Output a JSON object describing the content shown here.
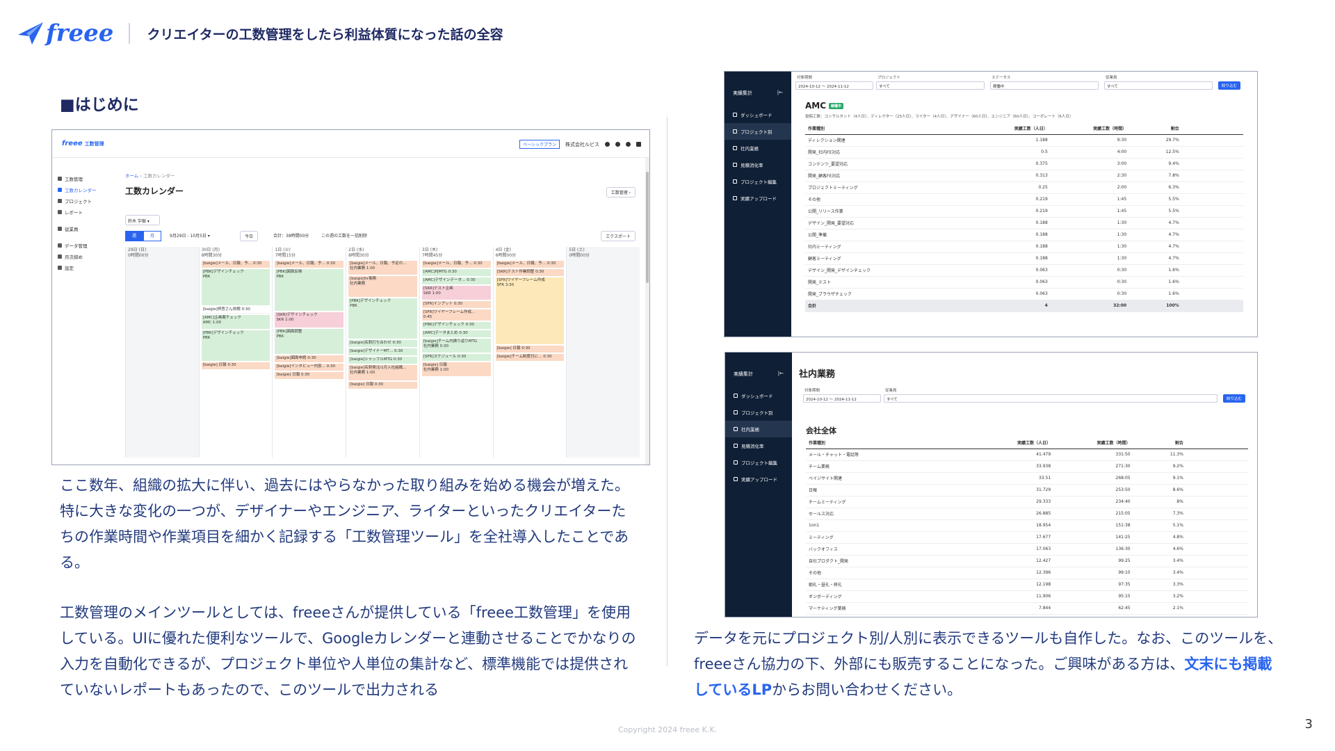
{
  "header": {
    "logo_text": "freee",
    "title": "クリエイターの工数管理をしたら利益体質になった話の全容"
  },
  "section_heading": "■はじめに",
  "paragraphs": {
    "p1": "ここ数年、組織の拡大に伴い、過去にはやらなかった取り組みを始める機会が増えた。特に大きな変化の一つが、デザイナーやエンジニア、ライターといったクリエイターたちの作業時間や作業項目を細かく記録する「工数管理ツール」を全社導入したことである。",
    "p2": "工数管理のメインツールとしては、freeeさんが提供している「freee工数管理」を使用している。UIに優れた便利なツールで、Googleカレンダーと連動させることでかなりの入力を自動化できるが、プロジェクト単位や人単位の集計など、標準機能では提供されていないレポートもあったので、このツールで出力される",
    "p3_pre": "データを元にプロジェクト別/人別に表示できるツールも自作した。なお、このツールを、freeeさん協力の下、外部にも販売することになった。ご興味がある方は、",
    "p3_link": "文末にも掲載しているLP",
    "p3_post": "からお問い合わせください。"
  },
  "footer": "Copyright 2024 freee K.K.",
  "page_number": "3",
  "calendar": {
    "logo": "freee",
    "app_name": "工数管理",
    "plan": "ベーシックプラン",
    "company": "株式会社ルビス",
    "sidebar": [
      "工数管理",
      "工数カレンダー",
      "プロジェクト",
      "レポート",
      "従業員",
      "データ管理",
      "月次締め",
      "設定"
    ],
    "breadcrumb_home": "ホーム",
    "breadcrumb_current": "工数カレンダー",
    "title": "工数カレンダー",
    "manage_btn": "工数管理 ›",
    "user_select": "鈴木 宇樹 ▾",
    "view_week": "週",
    "view_month": "月",
    "range": "9月29日 - 10月5日 ▾",
    "today": "今日",
    "total": "合計：38時間00分",
    "copy_week": "この週の工数を一括削除",
    "export": "エクスポート",
    "days": [
      {
        "d": "29日 (日)",
        "t": "0時間00分"
      },
      {
        "d": "30日 (月)",
        "t": "8時間30分"
      },
      {
        "d": "1日 (火)",
        "t": "7時間15分"
      },
      {
        "d": "2日 (水)",
        "t": "8時間30分"
      },
      {
        "d": "3日 (木)",
        "t": "7時間45分"
      },
      {
        "d": "4日 (金)",
        "t": "6時間00分"
      },
      {
        "d": "5日 (土)",
        "t": "0時間00分"
      }
    ],
    "events": {
      "mon": [
        [
          "[baigie]メール、日報、予…",
          "0:30"
        ],
        [
          "[PBK]デザインチェック",
          "PBK"
        ],
        [
          "[baigie]拝啓さん依頼",
          "0:30"
        ],
        [
          "[AMC]企画案チェック",
          "AMC 1:00"
        ],
        [
          "[PBK]デザインチェック",
          "PBK"
        ],
        [
          "[baigie] 日報",
          "0:30"
        ]
      ],
      "tue": [
        [
          "[baigie]メール、日報、予…",
          "0:30"
        ],
        [
          "[PBK]図面反映",
          "PBK"
        ],
        [
          "[SKR]デザインチェック",
          "SKR 1:00"
        ],
        [
          "[PBK]図面調整",
          "PBK"
        ],
        [
          "[baigie]図面申請",
          "0:30"
        ],
        [
          "[baigie]インタビュー内容…",
          "0:30"
        ],
        [
          "[baigie] 日報",
          "0:30"
        ]
      ],
      "wed": [
        [
          "[baigie]メール、日報、予定の…",
          "社内業務 1:00"
        ],
        [
          "[baigie]hr事務",
          "社内業務"
        ],
        [
          "[PBK]デザインチェック",
          "PBK"
        ],
        [
          "[baigie]名刺打ち合わせ",
          "0:30"
        ],
        [
          "[baigie]デザイナーMT…",
          "0:30"
        ],
        [
          "[baigie]シャッフルMTG",
          "0:30"
        ],
        [
          "[baigie]名刺発注/1月入社組織…",
          "社内業務 1:00"
        ],
        [
          "[baigie] 日報",
          "0:30"
        ]
      ],
      "thu": [
        [
          "[baigie]メール、日報、予…",
          "0:30"
        ],
        [
          "[AMC]PJMTG",
          "0:30"
        ],
        [
          "[AMC]デザインデータ…",
          "0:30"
        ],
        [
          "[SKR]テスト企画",
          "SKR 1:00"
        ],
        [
          "[SFR]インプット",
          "0:30"
        ],
        [
          "[SFR]ワイヤーフレーム作成…",
          "0:45"
        ],
        [
          "[PBK]デザインチェック",
          "0:30"
        ],
        [
          "[AMC]データまとめ",
          "0:30"
        ],
        [
          "[baigie]チーム内振り返りMTG",
          "社内業務 0:30"
        ],
        [
          "[SFR]スケジュール",
          "0:30"
        ],
        [
          "[baigie] 日報",
          "社内業務 1:00"
        ]
      ],
      "fri": [
        [
          "[baigie]メール、日報、予…",
          "0:30"
        ],
        [
          "[SKR]テスト作業調整",
          "0:30"
        ],
        [
          "[SFR]ワイヤーフレーム作成",
          "SFR 3:30"
        ],
        [
          "[baigie] 日報",
          "0:30"
        ],
        [
          "[baigie]チーム制度付に…",
          "0:30"
        ]
      ]
    }
  },
  "dashboard1": {
    "sidebar_title": "実績集計",
    "sidebar": [
      "ダッシュボード",
      "プロジェクト別",
      "社内業務",
      "見積消化率",
      "プロジェクト編集",
      "実績アップロード"
    ],
    "filters": {
      "period_label": "対象期間",
      "from": "2024-10-12",
      "to": "2024-11-12",
      "project_label": "プロジェクト",
      "project": "すべて",
      "status_label": "ステータス",
      "status": "稼働中",
      "employee_label": "従業員",
      "employee": "すべて",
      "button": "絞り込む"
    },
    "title": "AMC",
    "badge": "稼働中",
    "sub": "投稿工数：コンサルタント（4人日）、ディレクター（25人日）、ライター（4人日）、デザイナー（60人日）、エンジニア（60人日）、コーポレート（6人日）",
    "columns": [
      "作業種別",
      "実績工数（人日）",
      "実績工数（時間）",
      "割合"
    ],
    "rows": [
      [
        "ディレクション関連",
        "1.188",
        "9:30",
        "29.7%"
      ],
      [
        "開発_社内FE対応",
        "0.5",
        "4:00",
        "12.5%"
      ],
      [
        "コンテンツ_要望対応",
        "0.375",
        "3:00",
        "9.4%"
      ],
      [
        "開発_顧客FE対応",
        "0.313",
        "2:30",
        "7.8%"
      ],
      [
        "プロジェクトミーティング",
        "0.25",
        "2:00",
        "6.3%"
      ],
      [
        "その他",
        "0.219",
        "1:45",
        "5.5%"
      ],
      [
        "公開_リリース作業",
        "0.219",
        "1:45",
        "5.5%"
      ],
      [
        "デザイン_開発_要望対応",
        "0.188",
        "1:30",
        "4.7%"
      ],
      [
        "公開_準備",
        "0.188",
        "1:30",
        "4.7%"
      ],
      [
        "社内ミーティング",
        "0.188",
        "1:30",
        "4.7%"
      ],
      [
        "顧客ミーティング",
        "0.188",
        "1:30",
        "4.7%"
      ],
      [
        "デザイン_開発_デザインチェック",
        "0.063",
        "0:30",
        "1.6%"
      ],
      [
        "開発_テスト",
        "0.063",
        "0:30",
        "1.6%"
      ],
      [
        "開発_ブラウザチェック",
        "0.063",
        "0:30",
        "1.6%"
      ]
    ],
    "total": [
      "合計",
      "4",
      "32:00",
      "100%"
    ]
  },
  "dashboard2": {
    "sidebar_title": "実績集計",
    "sidebar": [
      "ダッシュボード",
      "プロジェクト別",
      "社内業務",
      "見積消化率",
      "プロジェクト編集",
      "実績アップロード"
    ],
    "page_title": "社内業務",
    "filters": {
      "period_label": "対象期間",
      "from": "2024-10-12",
      "to": "2024-11-12",
      "employee_label": "従業員",
      "employee": "すべて",
      "button": "絞り込む"
    },
    "subtitle": "会社全体",
    "columns": [
      "作業種別",
      "実績工数（人日）",
      "実績工数（時間）",
      "割合"
    ],
    "rows": [
      [
        "メール・チャット・電話等",
        "41.479",
        "331:50",
        "11.3%"
      ],
      [
        "チーム業務",
        "33.938",
        "271:30",
        "9.2%"
      ],
      [
        "ベイジサイト関連",
        "33.51",
        "268:05",
        "9.1%"
      ],
      [
        "日報",
        "31.729",
        "253:50",
        "8.6%"
      ],
      [
        "チームミーティング",
        "29.333",
        "234:40",
        "8%"
      ],
      [
        "セールス対応",
        "26.885",
        "215:05",
        "7.3%"
      ],
      [
        "1on1",
        "18.954",
        "151:38",
        "5.1%"
      ],
      [
        "ミーティング",
        "17.677",
        "141:25",
        "4.8%"
      ],
      [
        "バックオフィス",
        "17.063",
        "136:30",
        "4.6%"
      ],
      [
        "自社プロダクト_開発",
        "12.427",
        "99:25",
        "3.4%"
      ],
      [
        "その他",
        "12.396",
        "99:10",
        "3.4%"
      ],
      [
        "朝礼・昼礼・終礼",
        "12.198",
        "97:35",
        "3.3%"
      ],
      [
        "オンボーディング",
        "11.906",
        "95:15",
        "3.2%"
      ],
      [
        "マーケティング業務",
        "7.844",
        "62:45",
        "2.1%"
      ]
    ]
  }
}
